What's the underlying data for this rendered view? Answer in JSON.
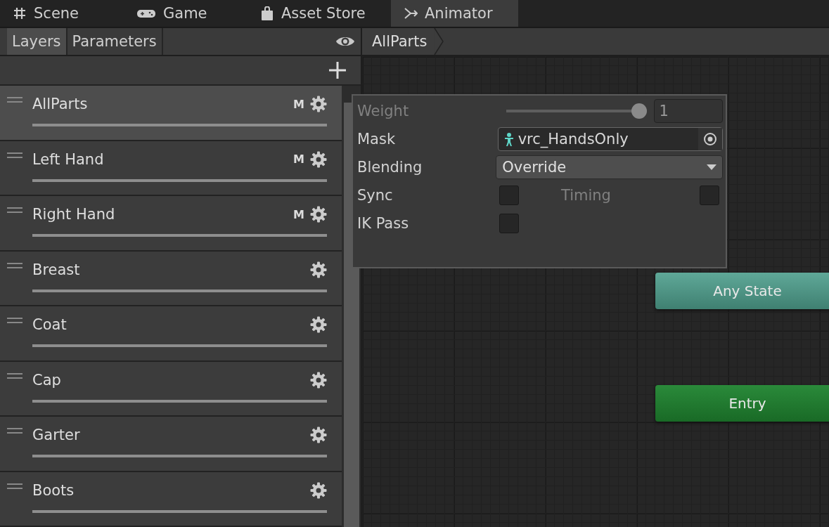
{
  "window_tabs": [
    {
      "label": "Scene",
      "selected": false
    },
    {
      "label": "Game",
      "selected": false
    },
    {
      "label": "Asset Store",
      "selected": false
    },
    {
      "label": "Animator",
      "selected": true
    }
  ],
  "side_tabs": [
    {
      "label": "Layers",
      "selected": true
    },
    {
      "label": "Parameters",
      "selected": false
    }
  ],
  "breadcrumb": "AllParts",
  "layers": [
    {
      "name": "AllParts",
      "selected": true,
      "badge": "M",
      "level": 1
    },
    {
      "name": "Left Hand",
      "selected": false,
      "badge": "M",
      "level": 1
    },
    {
      "name": "Right Hand",
      "selected": false,
      "badge": "M",
      "level": 1
    },
    {
      "name": "Breast",
      "selected": false,
      "level": 1
    },
    {
      "name": "Coat",
      "selected": false,
      "level": 1
    },
    {
      "name": "Cap",
      "selected": false,
      "level": 1
    },
    {
      "name": "Garter",
      "selected": false,
      "level": 1
    },
    {
      "name": "Boots",
      "selected": false,
      "level": 1
    }
  ],
  "layer_settings": {
    "weight": {
      "label": "Weight",
      "disabled": true,
      "level": 1,
      "value": "1"
    },
    "mask": {
      "label": "Mask",
      "value": "vrc_HandsOnly"
    },
    "blending": {
      "label": "Blending",
      "value": "Override"
    },
    "sync": {
      "label": "Sync",
      "checked": false
    },
    "timing": {
      "label": "Timing",
      "disabled": true,
      "checked": false
    },
    "ik_pass": {
      "label": "IK Pass",
      "checked": false
    }
  },
  "states": [
    {
      "name": "Any State",
      "kind": "any"
    },
    {
      "name": "Entry",
      "kind": "entry"
    }
  ]
}
